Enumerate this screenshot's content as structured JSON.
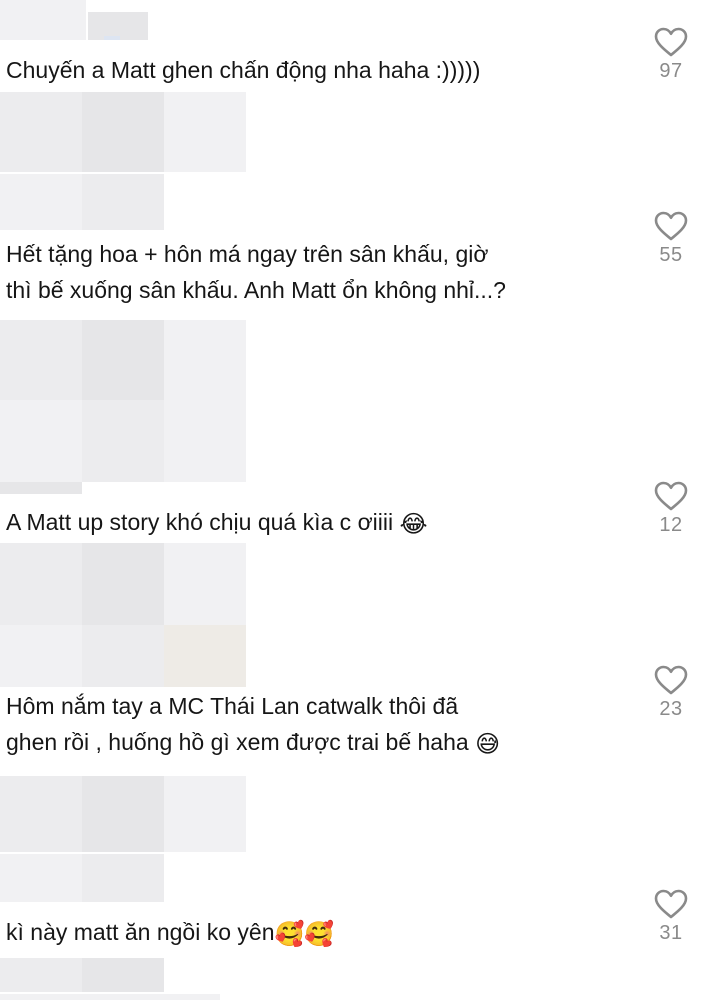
{
  "comments": [
    {
      "text": "Chuyến a Matt ghen chấn động nha haha :)))))",
      "emoji": "",
      "likes": "97"
    },
    {
      "line1": "Hết tặng hoa + hôn má ngay trên sân khấu, giờ",
      "line2": "thì bế xuống sân khấu. Anh Matt ổn không nhỉ...?",
      "likes": "55"
    },
    {
      "text": "A Matt up story khó chịu quá kìa c ơiiii ",
      "emoji": "😂",
      "likes": "12"
    },
    {
      "line1": "Hôm nắm tay a MC Thái Lan catwalk thôi đã",
      "line2": "ghen rồi , huống hồ gì xem được trai bế haha ",
      "emoji": "😅",
      "likes": "23"
    },
    {
      "text": "kì này matt ăn ngồi ko yên",
      "emoji": "🥰🥰",
      "likes": "31"
    }
  ],
  "icons": {
    "like": "heart-outline-icon"
  },
  "colors": {
    "text": "#161616",
    "like_count": "#8a8a8a",
    "heart_stroke": "#8a8a8a",
    "placeholder": "#ececee"
  }
}
